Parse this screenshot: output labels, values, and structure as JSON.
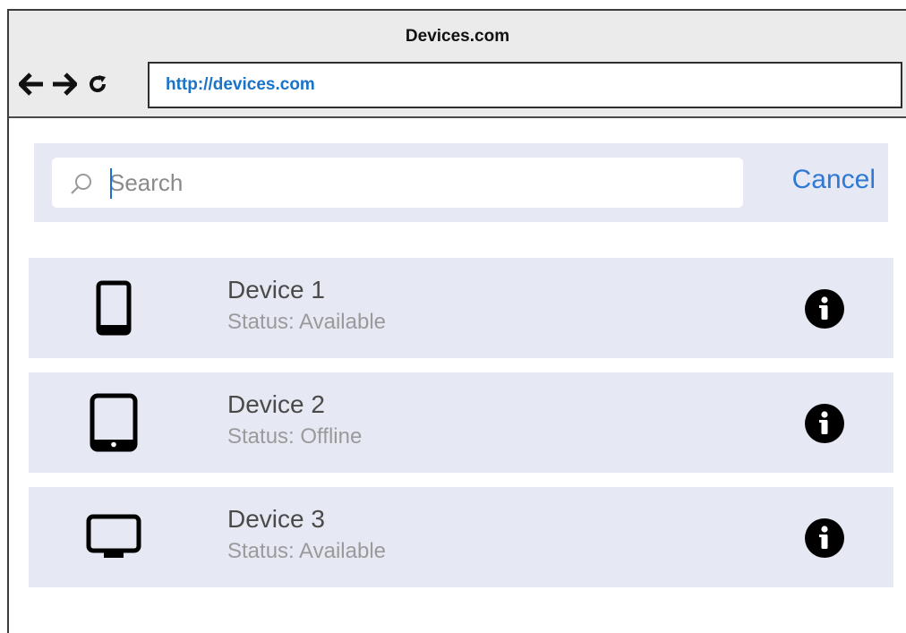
{
  "window": {
    "title": "Devices.com"
  },
  "browser": {
    "url": "http://devices.com",
    "icons": {
      "back": "arrow-left-icon",
      "forward": "arrow-right-icon",
      "reload": "reload-icon"
    }
  },
  "search": {
    "placeholder": "Search",
    "value": "",
    "cancel_label": "Cancel",
    "icon": "search-icon"
  },
  "devices": [
    {
      "name": "Device 1",
      "status": "Status: Available",
      "icon": "phone-icon"
    },
    {
      "name": "Device 2",
      "status": "Status: Offline",
      "icon": "tablet-icon"
    },
    {
      "name": "Device 3",
      "status": "Status: Available",
      "icon": "monitor-icon"
    }
  ],
  "colors": {
    "accent": "#2f78d4",
    "url": "#1a73c8",
    "row_background": "#e6e9f4",
    "chrome_background": "#ebebeb"
  }
}
